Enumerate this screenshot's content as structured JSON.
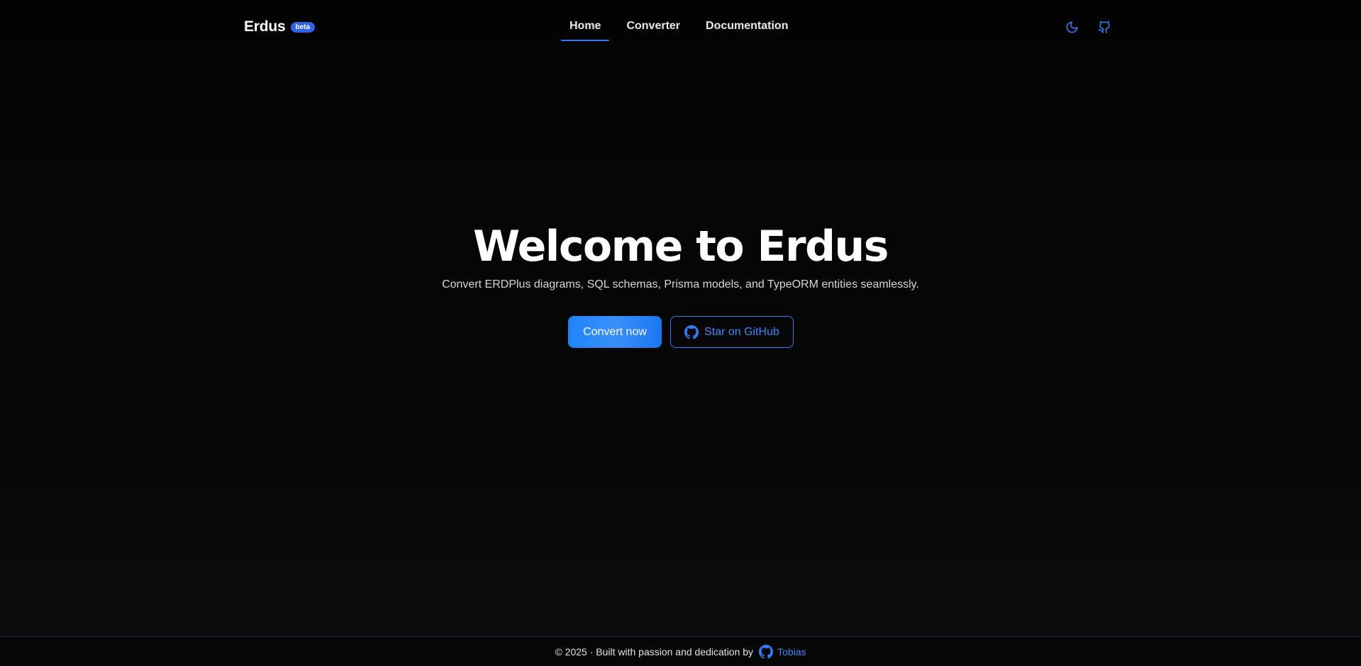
{
  "header": {
    "brand": "Erdus",
    "badge": "beta",
    "nav": [
      {
        "label": "Home",
        "active": true
      },
      {
        "label": "Converter",
        "active": false
      },
      {
        "label": "Documentation",
        "active": false
      }
    ],
    "icons": {
      "theme": "moon-icon",
      "repo": "github-icon"
    }
  },
  "hero": {
    "title": "Welcome to Erdus",
    "subtitle": "Convert ERDPlus diagrams, SQL schemas, Prisma models, and TypeORM entities seamlessly.",
    "primary_label": "Convert now",
    "secondary_label": "Star on GitHub"
  },
  "footer": {
    "text": "© 2025 · Built with passion and dedication by",
    "author": "Tobias"
  },
  "colors": {
    "accent": "#2f7df6",
    "badge": "#2f62e8",
    "background": "#050505"
  }
}
